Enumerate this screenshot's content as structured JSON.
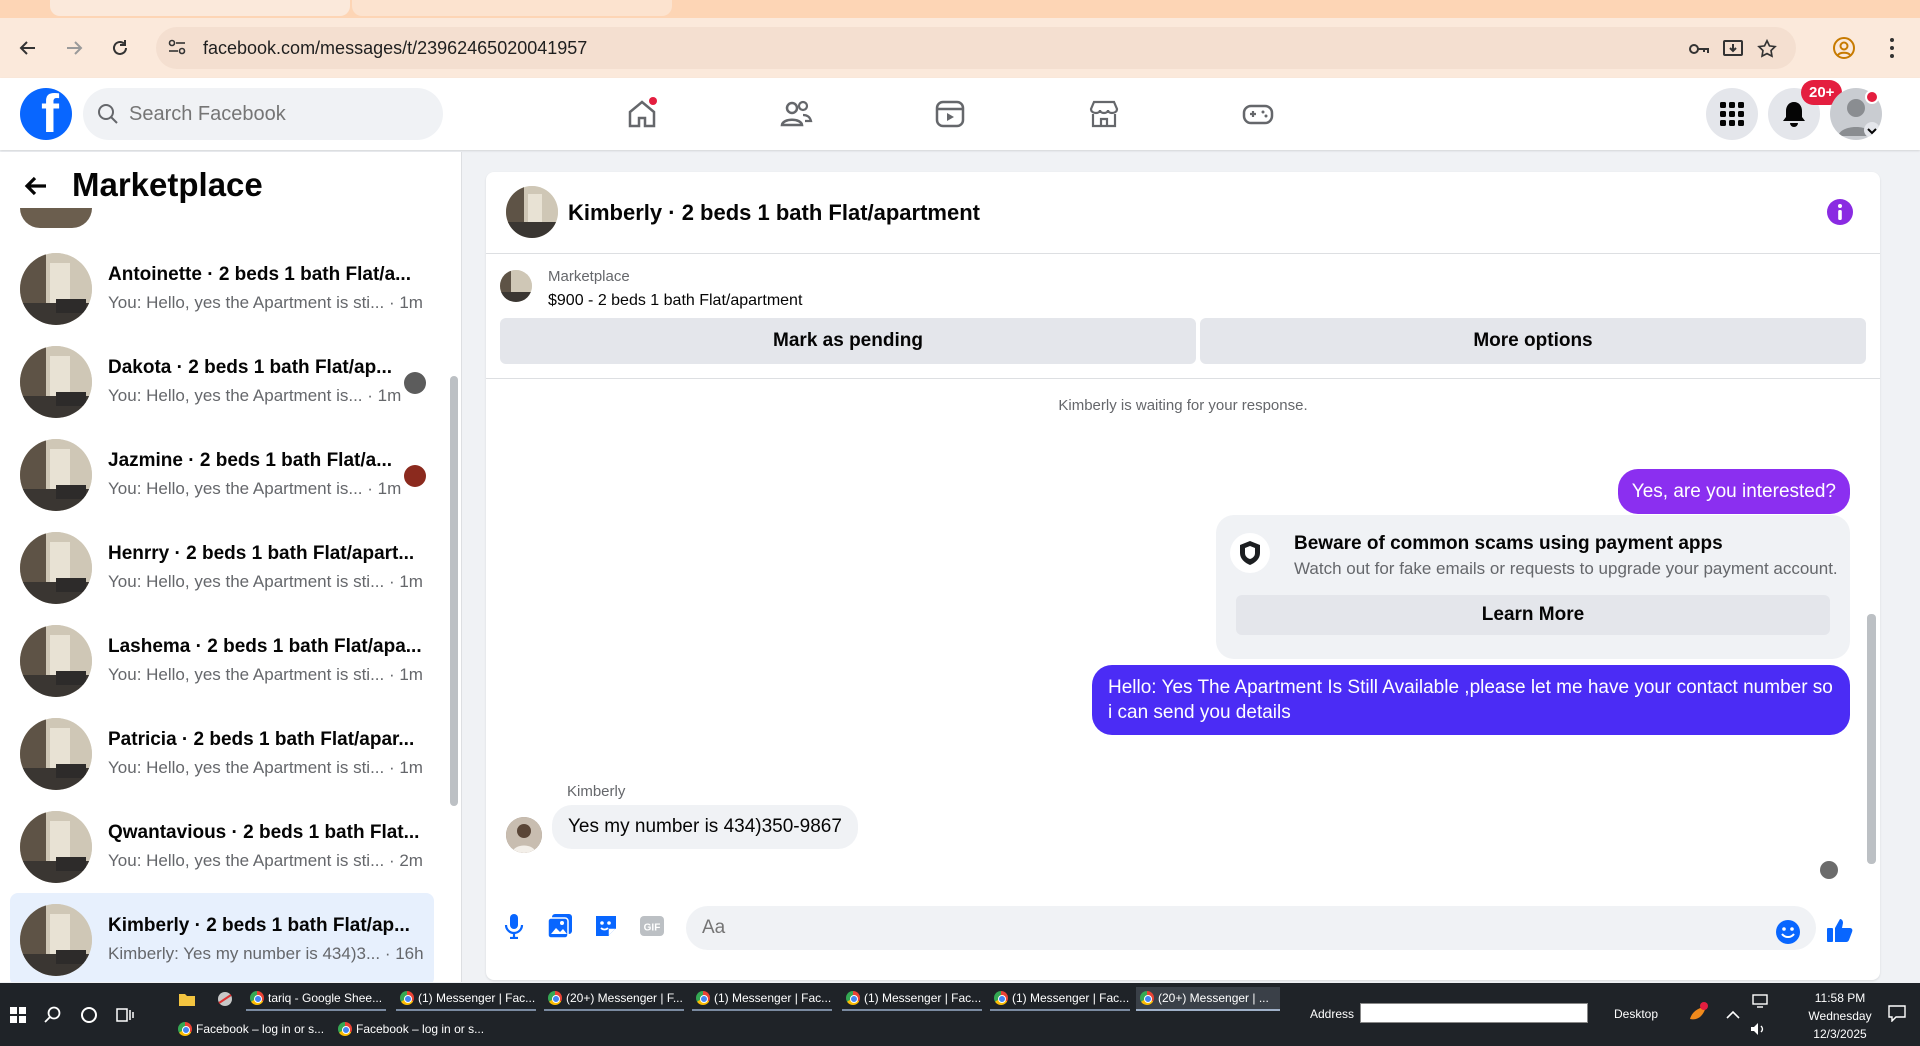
{
  "browser": {
    "url": "facebook.com/messages/t/23962465020041957"
  },
  "fb": {
    "search_placeholder": "Search Facebook",
    "notifications_badge": "20+",
    "colors": {
      "brand": "#0866ff",
      "outgoing_bubble": "#7b2ff2",
      "outgoing_bubble2": "#4b2cf5",
      "badge": "#e41e3f"
    }
  },
  "sidebar": {
    "title": "Marketplace",
    "conversations": [
      {
        "name": "Antoinette · 2 beds 1 bath Flat/a...",
        "preview": "You: Hello, yes the Apartment is sti... · 1m"
      },
      {
        "name": "Dakota · 2 beds 1 bath Flat/ap...",
        "preview": "You: Hello, yes the Apartment is... · 1m"
      },
      {
        "name": "Jazmine · 2 beds 1 bath Flat/a...",
        "preview": "You: Hello, yes the Apartment is... · 1m"
      },
      {
        "name": "Henrry · 2 beds 1 bath Flat/apart...",
        "preview": "You: Hello, yes the Apartment is sti... · 1m"
      },
      {
        "name": "Lashema · 2 beds 1 bath Flat/apa...",
        "preview": "You: Hello, yes the Apartment is sti... · 1m"
      },
      {
        "name": "Patricia · 2 beds 1 bath Flat/apar...",
        "preview": "You: Hello, yes the Apartment is sti... · 1m"
      },
      {
        "name": "Qwantavious · 2 beds 1 bath Flat...",
        "preview": "You: Hello, yes the Apartment is sti... · 2m"
      },
      {
        "name": "Kimberly · 2 beds 1 bath Flat/ap...",
        "preview": "Kimberly: Yes my number is 434)3... · 16h"
      }
    ]
  },
  "chat": {
    "title": "Kimberly · 2 beds 1 bath Flat/apartment",
    "listing_source": "Marketplace",
    "listing_price": "$900 - 2 beds 1 bath Flat/apartment",
    "mark_pending_label": "Mark as pending",
    "more_options_label": "More options",
    "waiting_text": "Kimberly is waiting for your response.",
    "out_msg_1": "Yes, are you interested?",
    "scam_title": "Beware of common scams using payment apps",
    "scam_desc": "Watch out for fake emails or requests to upgrade your payment account.",
    "learn_more_label": "Learn More",
    "out_msg_2": "Hello: Yes The Apartment Is Still Available ,please let me have your contact number so i can send you details",
    "in_sender": "Kimberly",
    "in_msg": "Yes my number is 434)350-9867",
    "composer_placeholder": "Aa"
  },
  "taskbar": {
    "row1": [
      "tariq - Google Shee...",
      "(1) Messenger | Fac...",
      "(20+) Messenger | F...",
      "(1) Messenger | Fac...",
      "(1) Messenger | Fac...",
      "(1) Messenger | Fac...",
      "(20+) Messenger | ..."
    ],
    "row2": [
      "Facebook – log in or s...",
      "Facebook – log in or s..."
    ],
    "address_label": "Address",
    "desktop_label": "Desktop",
    "time": "11:58 PM",
    "day": "Wednesday",
    "date": "12/3/2025"
  }
}
